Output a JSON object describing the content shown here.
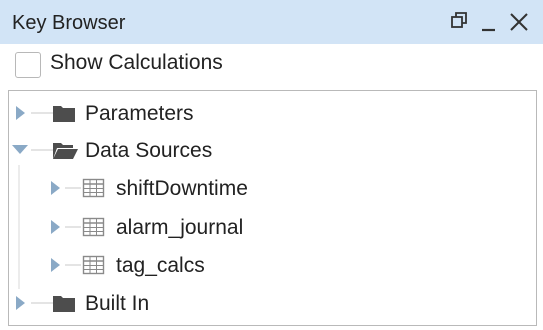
{
  "window": {
    "title": "Key Browser",
    "controls": [
      "restore-icon",
      "minimize-icon",
      "close-icon"
    ]
  },
  "options": {
    "show_calculations_label": "Show Calculations",
    "show_calculations_checked": false
  },
  "tree": {
    "nodes": [
      {
        "label": "Parameters",
        "icon": "folder-closed-icon",
        "expanded": false,
        "level": 0
      },
      {
        "label": "Data Sources",
        "icon": "folder-open-icon",
        "expanded": true,
        "level": 0
      },
      {
        "label": "shiftDowntime",
        "icon": "table-icon",
        "expanded": false,
        "level": 1
      },
      {
        "label": "alarm_journal",
        "icon": "table-icon",
        "expanded": false,
        "level": 1
      },
      {
        "label": "tag_calcs",
        "icon": "table-icon",
        "expanded": false,
        "level": 1
      },
      {
        "label": "Built In",
        "icon": "folder-closed-icon",
        "expanded": false,
        "level": 0
      }
    ]
  },
  "colors": {
    "titlebar_bg": "#d2e4f6",
    "tree_expander": "#8aa9c6",
    "folder_icon": "#4d4d4d",
    "table_icon": "#8a8a8a"
  }
}
